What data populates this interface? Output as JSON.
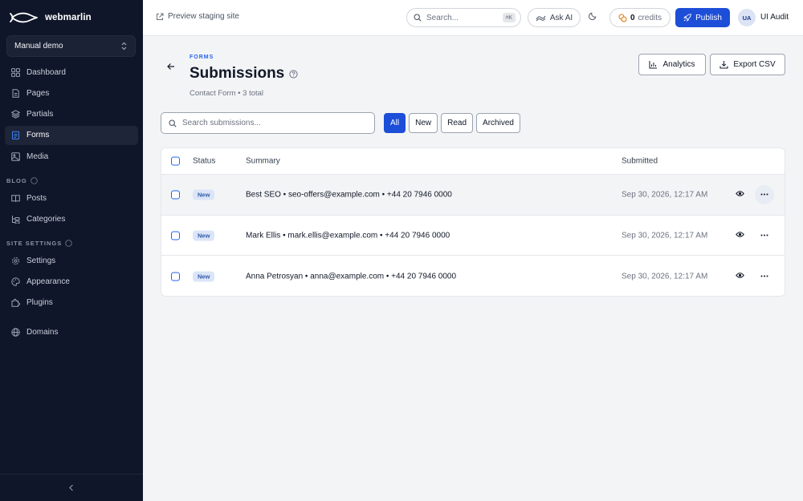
{
  "sidebar": {
    "brand": "webmarlin",
    "project": "Manual demo",
    "main_items": [
      {
        "label": "Dashboard",
        "icon": "grid-icon"
      },
      {
        "label": "Pages",
        "icon": "file-icon"
      },
      {
        "label": "Partials",
        "icon": "layers-icon"
      },
      {
        "label": "Forms",
        "icon": "clipboard-icon",
        "active": true
      },
      {
        "label": "Media",
        "icon": "image-icon"
      }
    ],
    "blog_label": "BLOG",
    "blog_items": [
      {
        "label": "Posts",
        "icon": "book-icon"
      },
      {
        "label": "Categories",
        "icon": "tree-icon"
      }
    ],
    "site_settings_label": "SITE SETTINGS",
    "settings_items": [
      {
        "label": "Settings",
        "icon": "gear-icon"
      },
      {
        "label": "Appearance",
        "icon": "palette-icon"
      },
      {
        "label": "Plugins",
        "icon": "puzzle-icon"
      }
    ],
    "domains_label": "Domains",
    "collapse_icon": "chevron-left-icon"
  },
  "topbar": {
    "preview_label": "Preview staging site",
    "search_placeholder": "Search...",
    "search_shortcut": "⌘K",
    "ask_ai_label": "Ask AI",
    "credits_count": "0",
    "credits_label": "credits",
    "publish_label": "Publish",
    "user_initials": "UA",
    "user_name": "UI Audit"
  },
  "header": {
    "eyebrow": "FORMS",
    "title": "Submissions",
    "subtitle": "Contact Form • 3 total",
    "analytics_label": "Analytics",
    "export_label": "Export CSV"
  },
  "toolbar": {
    "search_placeholder": "Search submissions...",
    "filters": [
      "All",
      "New",
      "Read",
      "Archived"
    ],
    "active_filter": "All"
  },
  "table": {
    "columns": {
      "status": "Status",
      "summary": "Summary",
      "submitted": "Submitted"
    },
    "rows": [
      {
        "status": "New",
        "summary": "Best SEO • seo-offers@example.com • +44 20 7946 0000",
        "submitted": "Sep 30, 2026, 12:17 AM"
      },
      {
        "status": "New",
        "summary": "Mark Ellis • mark.ellis@example.com • +44 20 7946 0000",
        "submitted": "Sep 30, 2026, 12:17 AM"
      },
      {
        "status": "New",
        "summary": "Anna Petrosyan • anna@example.com • +44 20 7946 0000",
        "submitted": "Sep 30, 2026, 12:17 AM"
      }
    ]
  },
  "colors": {
    "sidebar_bg": "#0f1629",
    "accent": "#1d4ed8",
    "badge_bg": "#dbe5f8",
    "badge_text": "#2f5aa8"
  }
}
